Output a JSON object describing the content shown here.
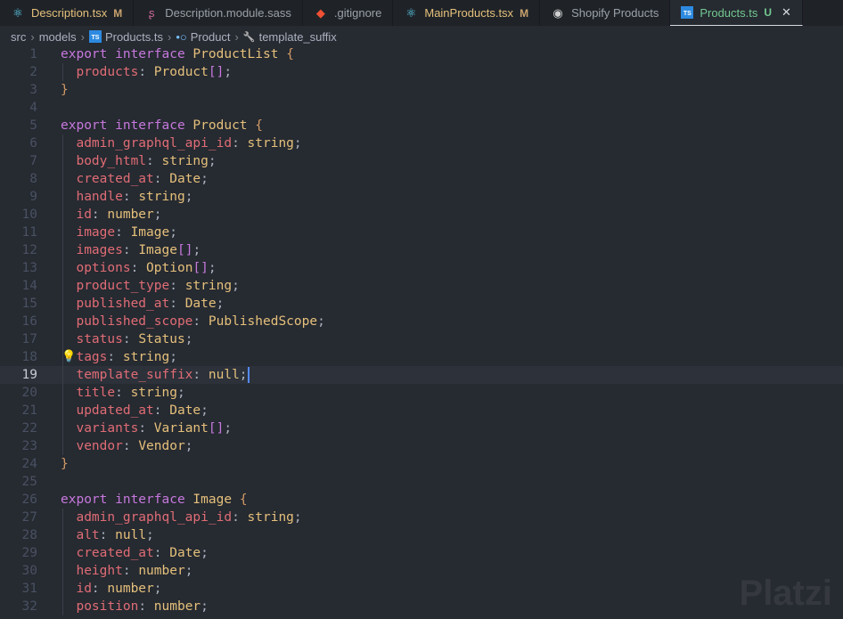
{
  "tabs": [
    {
      "icon": "react-icon",
      "name": "Description.tsx",
      "badge": "M",
      "modified": true
    },
    {
      "icon": "sass-icon",
      "name": "Description.module.sass",
      "badge": ""
    },
    {
      "icon": "git-icon",
      "name": ".gitignore",
      "badge": ""
    },
    {
      "icon": "react-icon",
      "name": "MainProducts.tsx",
      "badge": "M",
      "modified": true
    },
    {
      "icon": "extension-icon",
      "name": "Shopify Products",
      "badge": ""
    },
    {
      "icon": "typescript-icon",
      "name": "Products.ts",
      "badge": "U",
      "active": true,
      "close": "✕"
    }
  ],
  "breadcrumb": [
    "src",
    "models",
    "Products.ts",
    "Product",
    "template_suffix"
  ],
  "watermark": "Platzi",
  "current_line": 19,
  "lines": [
    [
      [
        "kw",
        "export "
      ],
      [
        "kw",
        "interface "
      ],
      [
        "ty",
        "ProductList "
      ],
      [
        "br",
        "{"
      ]
    ],
    [
      [
        "pr",
        "  products"
      ],
      [
        "pu",
        ": "
      ],
      [
        "ty",
        "Product"
      ],
      [
        "bk",
        "[]"
      ],
      [
        "pu",
        ";"
      ]
    ],
    [
      [
        "br",
        "}"
      ]
    ],
    [],
    [
      [
        "kw",
        "export "
      ],
      [
        "kw",
        "interface "
      ],
      [
        "ty",
        "Product "
      ],
      [
        "br",
        "{"
      ]
    ],
    [
      [
        "pr",
        "  admin_graphql_api_id"
      ],
      [
        "pu",
        ": "
      ],
      [
        "ty",
        "string"
      ],
      [
        "pu",
        ";"
      ]
    ],
    [
      [
        "pr",
        "  body_html"
      ],
      [
        "pu",
        ": "
      ],
      [
        "ty",
        "string"
      ],
      [
        "pu",
        ";"
      ]
    ],
    [
      [
        "pr",
        "  created_at"
      ],
      [
        "pu",
        ": "
      ],
      [
        "ty",
        "Date"
      ],
      [
        "pu",
        ";"
      ]
    ],
    [
      [
        "pr",
        "  handle"
      ],
      [
        "pu",
        ": "
      ],
      [
        "ty",
        "string"
      ],
      [
        "pu",
        ";"
      ]
    ],
    [
      [
        "pr",
        "  id"
      ],
      [
        "pu",
        ": "
      ],
      [
        "ty",
        "number"
      ],
      [
        "pu",
        ";"
      ]
    ],
    [
      [
        "pr",
        "  image"
      ],
      [
        "pu",
        ": "
      ],
      [
        "ty",
        "Image"
      ],
      [
        "pu",
        ";"
      ]
    ],
    [
      [
        "pr",
        "  images"
      ],
      [
        "pu",
        ": "
      ],
      [
        "ty",
        "Image"
      ],
      [
        "bk",
        "[]"
      ],
      [
        "pu",
        ";"
      ]
    ],
    [
      [
        "pr",
        "  options"
      ],
      [
        "pu",
        ": "
      ],
      [
        "ty",
        "Option"
      ],
      [
        "bk",
        "[]"
      ],
      [
        "pu",
        ";"
      ]
    ],
    [
      [
        "pr",
        "  product_type"
      ],
      [
        "pu",
        ": "
      ],
      [
        "ty",
        "string"
      ],
      [
        "pu",
        ";"
      ]
    ],
    [
      [
        "pr",
        "  published_at"
      ],
      [
        "pu",
        ": "
      ],
      [
        "ty",
        "Date"
      ],
      [
        "pu",
        ";"
      ]
    ],
    [
      [
        "pr",
        "  published_scope"
      ],
      [
        "pu",
        ": "
      ],
      [
        "ty",
        "PublishedScope"
      ],
      [
        "pu",
        ";"
      ]
    ],
    [
      [
        "pr",
        "  status"
      ],
      [
        "pu",
        ": "
      ],
      [
        "ty",
        "Status"
      ],
      [
        "pu",
        ";"
      ]
    ],
    [
      [
        "pr",
        "  tags"
      ],
      [
        "pu",
        ": "
      ],
      [
        "ty",
        "string"
      ],
      [
        "pu",
        ";"
      ]
    ],
    [
      [
        "pr",
        "  template_suffix"
      ],
      [
        "pu",
        ": "
      ],
      [
        "ty",
        "null"
      ],
      [
        "pu",
        ";"
      ]
    ],
    [
      [
        "pr",
        "  title"
      ],
      [
        "pu",
        ": "
      ],
      [
        "ty",
        "string"
      ],
      [
        "pu",
        ";"
      ]
    ],
    [
      [
        "pr",
        "  updated_at"
      ],
      [
        "pu",
        ": "
      ],
      [
        "ty",
        "Date"
      ],
      [
        "pu",
        ";"
      ]
    ],
    [
      [
        "pr",
        "  variants"
      ],
      [
        "pu",
        ": "
      ],
      [
        "ty",
        "Variant"
      ],
      [
        "bk",
        "[]"
      ],
      [
        "pu",
        ";"
      ]
    ],
    [
      [
        "pr",
        "  vendor"
      ],
      [
        "pu",
        ": "
      ],
      [
        "ty",
        "Vendor"
      ],
      [
        "pu",
        ";"
      ]
    ],
    [
      [
        "br",
        "}"
      ]
    ],
    [],
    [
      [
        "kw",
        "export "
      ],
      [
        "kw",
        "interface "
      ],
      [
        "ty",
        "Image "
      ],
      [
        "br",
        "{"
      ]
    ],
    [
      [
        "pr",
        "  admin_graphql_api_id"
      ],
      [
        "pu",
        ": "
      ],
      [
        "ty",
        "string"
      ],
      [
        "pu",
        ";"
      ]
    ],
    [
      [
        "pr",
        "  alt"
      ],
      [
        "pu",
        ": "
      ],
      [
        "ty",
        "null"
      ],
      [
        "pu",
        ";"
      ]
    ],
    [
      [
        "pr",
        "  created_at"
      ],
      [
        "pu",
        ": "
      ],
      [
        "ty",
        "Date"
      ],
      [
        "pu",
        ";"
      ]
    ],
    [
      [
        "pr",
        "  height"
      ],
      [
        "pu",
        ": "
      ],
      [
        "ty",
        "number"
      ],
      [
        "pu",
        ";"
      ]
    ],
    [
      [
        "pr",
        "  id"
      ],
      [
        "pu",
        ": "
      ],
      [
        "ty",
        "number"
      ],
      [
        "pu",
        ";"
      ]
    ],
    [
      [
        "pr",
        "  position"
      ],
      [
        "pu",
        ": "
      ],
      [
        "ty",
        "number"
      ],
      [
        "pu",
        ";"
      ]
    ]
  ]
}
